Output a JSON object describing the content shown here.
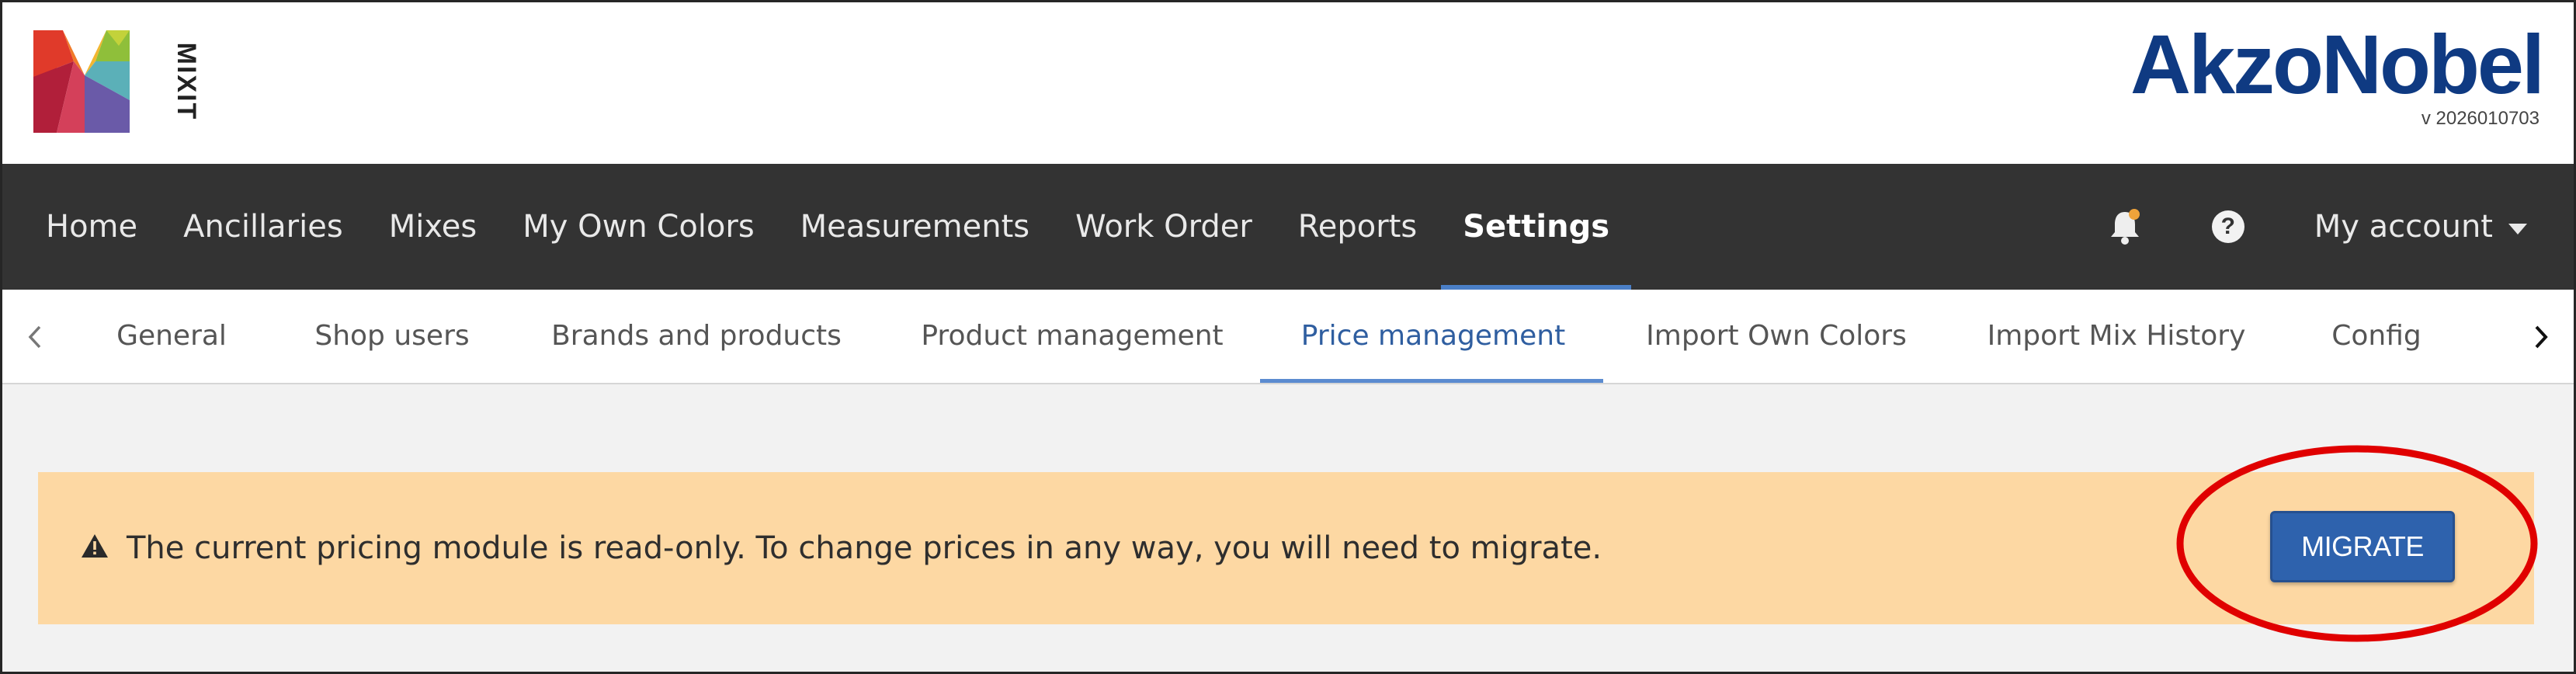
{
  "header": {
    "logo_text": "MIXIT",
    "brand_name": "AkzoNobel",
    "version": "v 2026010703"
  },
  "main_nav": {
    "items": [
      {
        "label": "Home"
      },
      {
        "label": "Ancillaries"
      },
      {
        "label": "Mixes"
      },
      {
        "label": "My Own Colors"
      },
      {
        "label": "Measurements"
      },
      {
        "label": "Work Order"
      },
      {
        "label": "Reports"
      },
      {
        "label": "Settings",
        "active": true
      }
    ],
    "help_symbol": "?",
    "account_label": "My account",
    "icons": {
      "notifications": "bell-icon",
      "help": "question-circle-icon",
      "account_menu": "caret-down-icon"
    }
  },
  "sub_nav": {
    "tabs": [
      {
        "label": "General"
      },
      {
        "label": "Shop users"
      },
      {
        "label": "Brands and products"
      },
      {
        "label": "Product management"
      },
      {
        "label": "Price management",
        "active": true
      },
      {
        "label": "Import Own Colors"
      },
      {
        "label": "Import Mix History"
      },
      {
        "label": "Config"
      }
    ],
    "icons": {
      "scroll_left": "chevron-left-icon",
      "scroll_right": "chevron-right-icon"
    }
  },
  "alert": {
    "icon": "warning-icon",
    "message": "The current pricing module is read-only. To change prices in any way, you will need to migrate.",
    "button_label": "MIGRATE"
  },
  "colors": {
    "header_bg": "#ffffff",
    "nav_bg": "#333333",
    "brand_blue": "#0f3a82",
    "active_tab": "#2f5ea0",
    "alert_bg": "#fdd8a3",
    "button_bg": "#2e62ad",
    "highlight": "#e00000",
    "content_bg": "#f2f2f2"
  }
}
